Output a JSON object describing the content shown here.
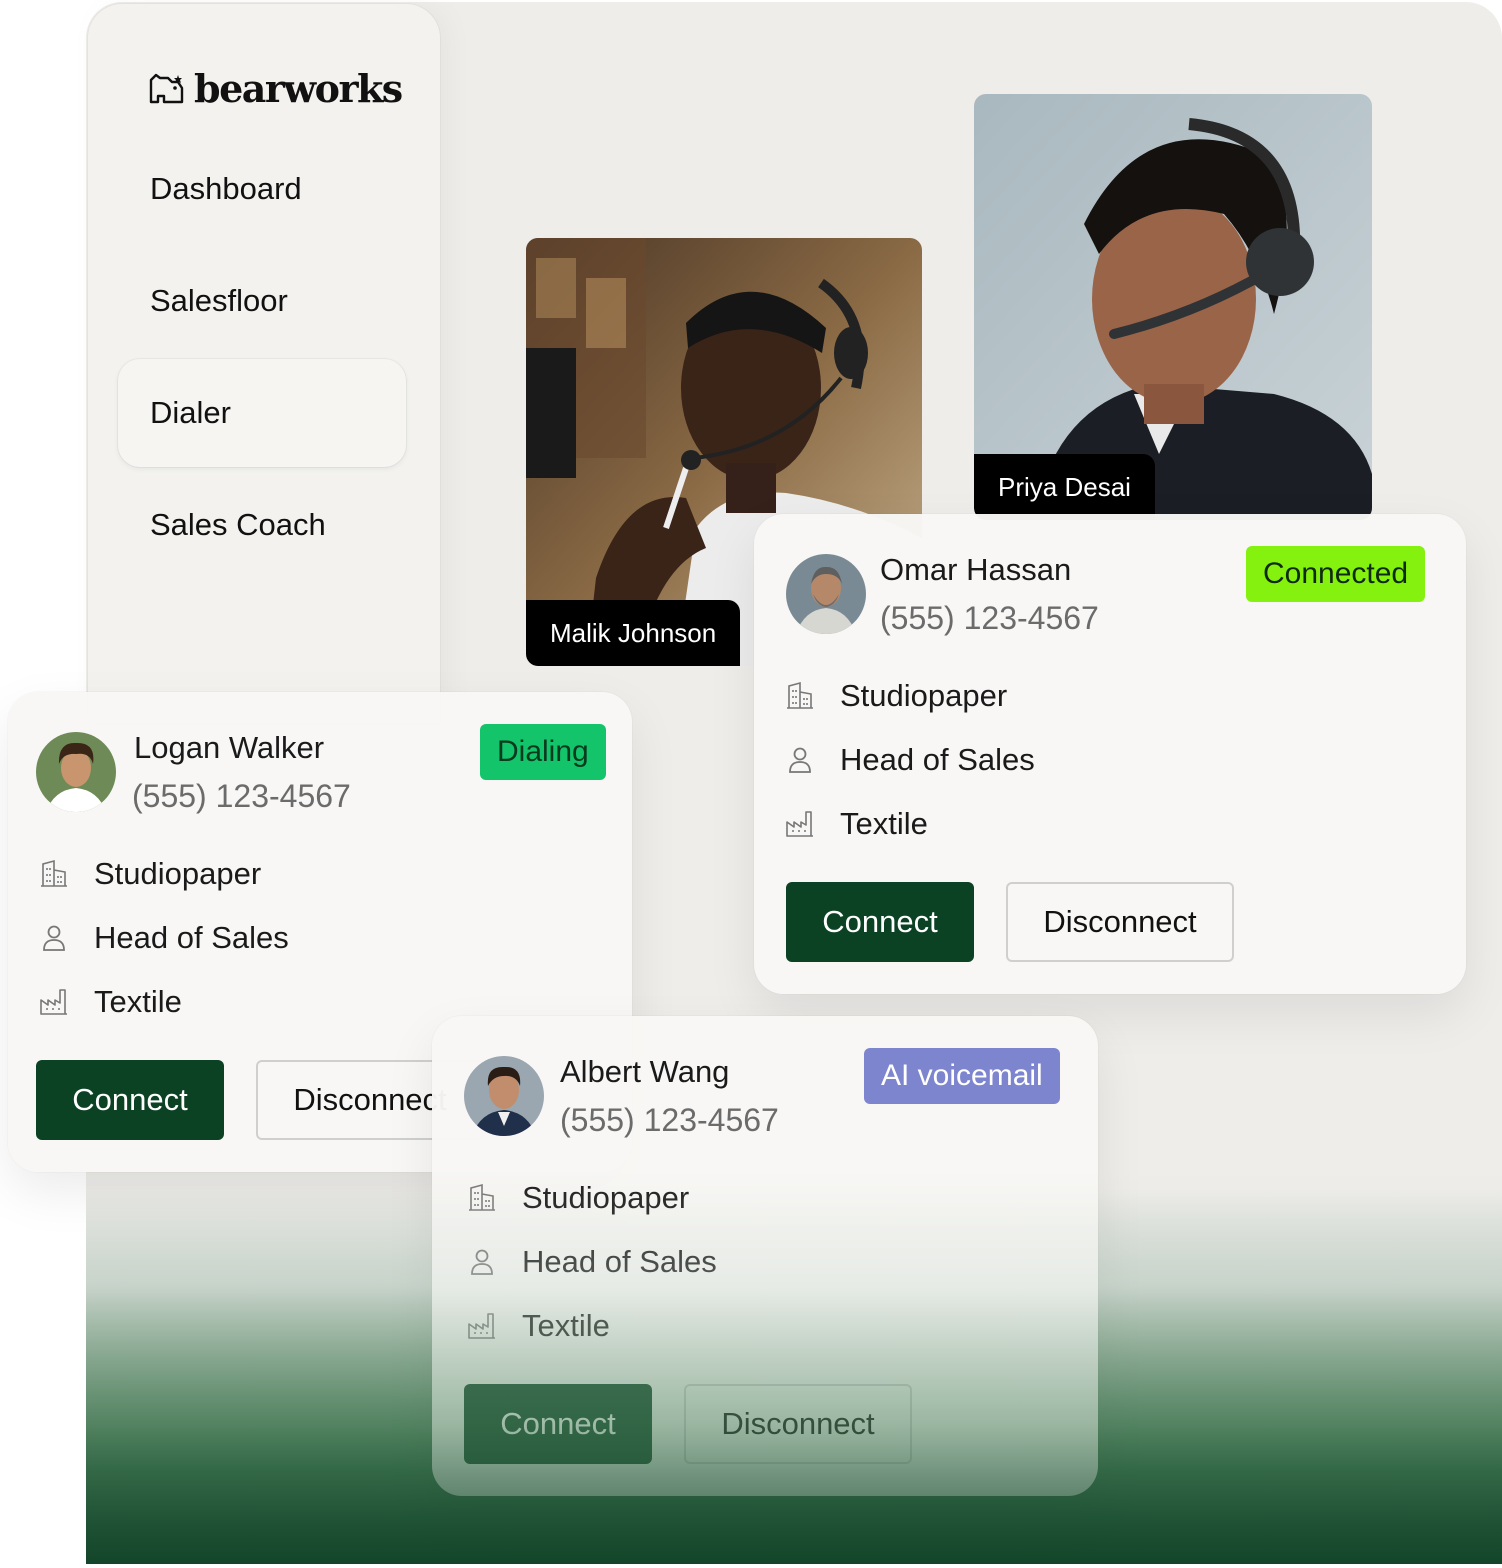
{
  "brand": {
    "name": "bearworks",
    "icon": "bear-logo-icon"
  },
  "sidebar": {
    "items": [
      {
        "label": "Dashboard"
      },
      {
        "label": "Salesfloor"
      },
      {
        "label": "Dialer",
        "active": true
      },
      {
        "label": "Sales Coach"
      }
    ]
  },
  "videos": [
    {
      "name": "Malik Johnson"
    },
    {
      "name": "Priya Desai"
    }
  ],
  "cards": [
    {
      "name": "Omar Hassan",
      "phone": "(555) 123-4567",
      "status": "Connected",
      "status_bg": "#84f20e",
      "status_color": "#0f2a0f",
      "company": "Studiopaper",
      "role": "Head of Sales",
      "industry": "Textile",
      "connect_label": "Connect",
      "disconnect_label": "Disconnect"
    },
    {
      "name": "Logan Walker",
      "phone": "(555) 123-4567",
      "status": "Dialing",
      "status_bg": "#14c46a",
      "status_color": "#083a1e",
      "company": "Studiopaper",
      "role": "Head of Sales",
      "industry": "Textile",
      "connect_label": "Connect",
      "disconnect_label": "Disconnect"
    },
    {
      "name": "Albert Wang",
      "phone": "(555) 123-4567",
      "status": "AI voicemail",
      "status_bg": "#7e85cf",
      "status_color": "#ffffff",
      "company": "Studiopaper",
      "role": "Head of Sales",
      "industry": "Textile",
      "connect_label": "Connect",
      "disconnect_label": "Disconnect"
    }
  ],
  "icons": {
    "company": "building-icon",
    "role": "person-icon",
    "industry": "factory-icon"
  },
  "colors": {
    "primary_button": "#0b4224",
    "background": "#efedea",
    "footer_gradient_end": "#13452a"
  }
}
